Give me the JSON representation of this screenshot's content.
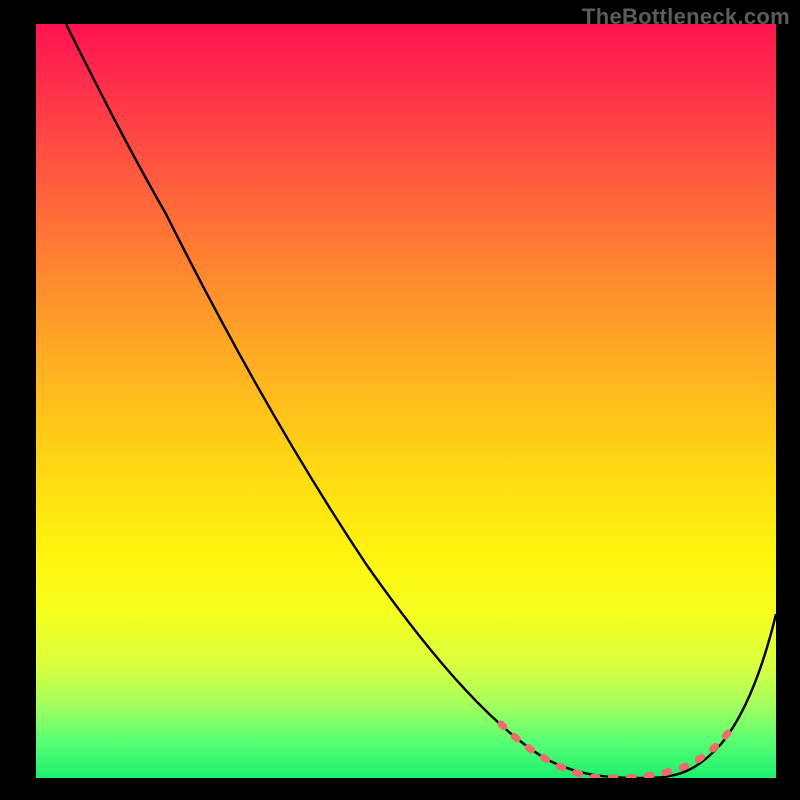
{
  "watermark": "TheBottleneck.com",
  "chart_data": {
    "type": "line",
    "title": "",
    "xlabel": "",
    "ylabel": "",
    "xlim": [
      0,
      100
    ],
    "ylim": [
      0,
      100
    ],
    "series": [
      {
        "name": "bottleneck-curve",
        "x": [
          0,
          8,
          15,
          25,
          35,
          45,
          55,
          62,
          67,
          72,
          76,
          80,
          84,
          88,
          92,
          96,
          100
        ],
        "values": [
          100,
          93,
          86,
          74,
          61,
          48,
          35,
          25,
          17,
          10,
          5,
          2,
          0,
          0,
          3,
          10,
          22
        ],
        "note": "Values estimated from curve shape relative to gradient; minimum (green/optimal) around x≈84-88, rising both directions toward red (high bottleneck)."
      },
      {
        "name": "optimal-range-markers",
        "x": [
          63,
          66,
          70,
          73,
          76,
          79,
          82,
          85,
          88,
          90
        ],
        "values": [
          22,
          17,
          11,
          7,
          4,
          2,
          1,
          0,
          0,
          3
        ],
        "note": "Dashed coral segment marking the low-bottleneck zone."
      }
    ],
    "colors": {
      "curve": "#000000",
      "marker_dash": "#ef6b6b",
      "gradient_top": "#ff1450",
      "gradient_bottom": "#1cf06e"
    }
  }
}
